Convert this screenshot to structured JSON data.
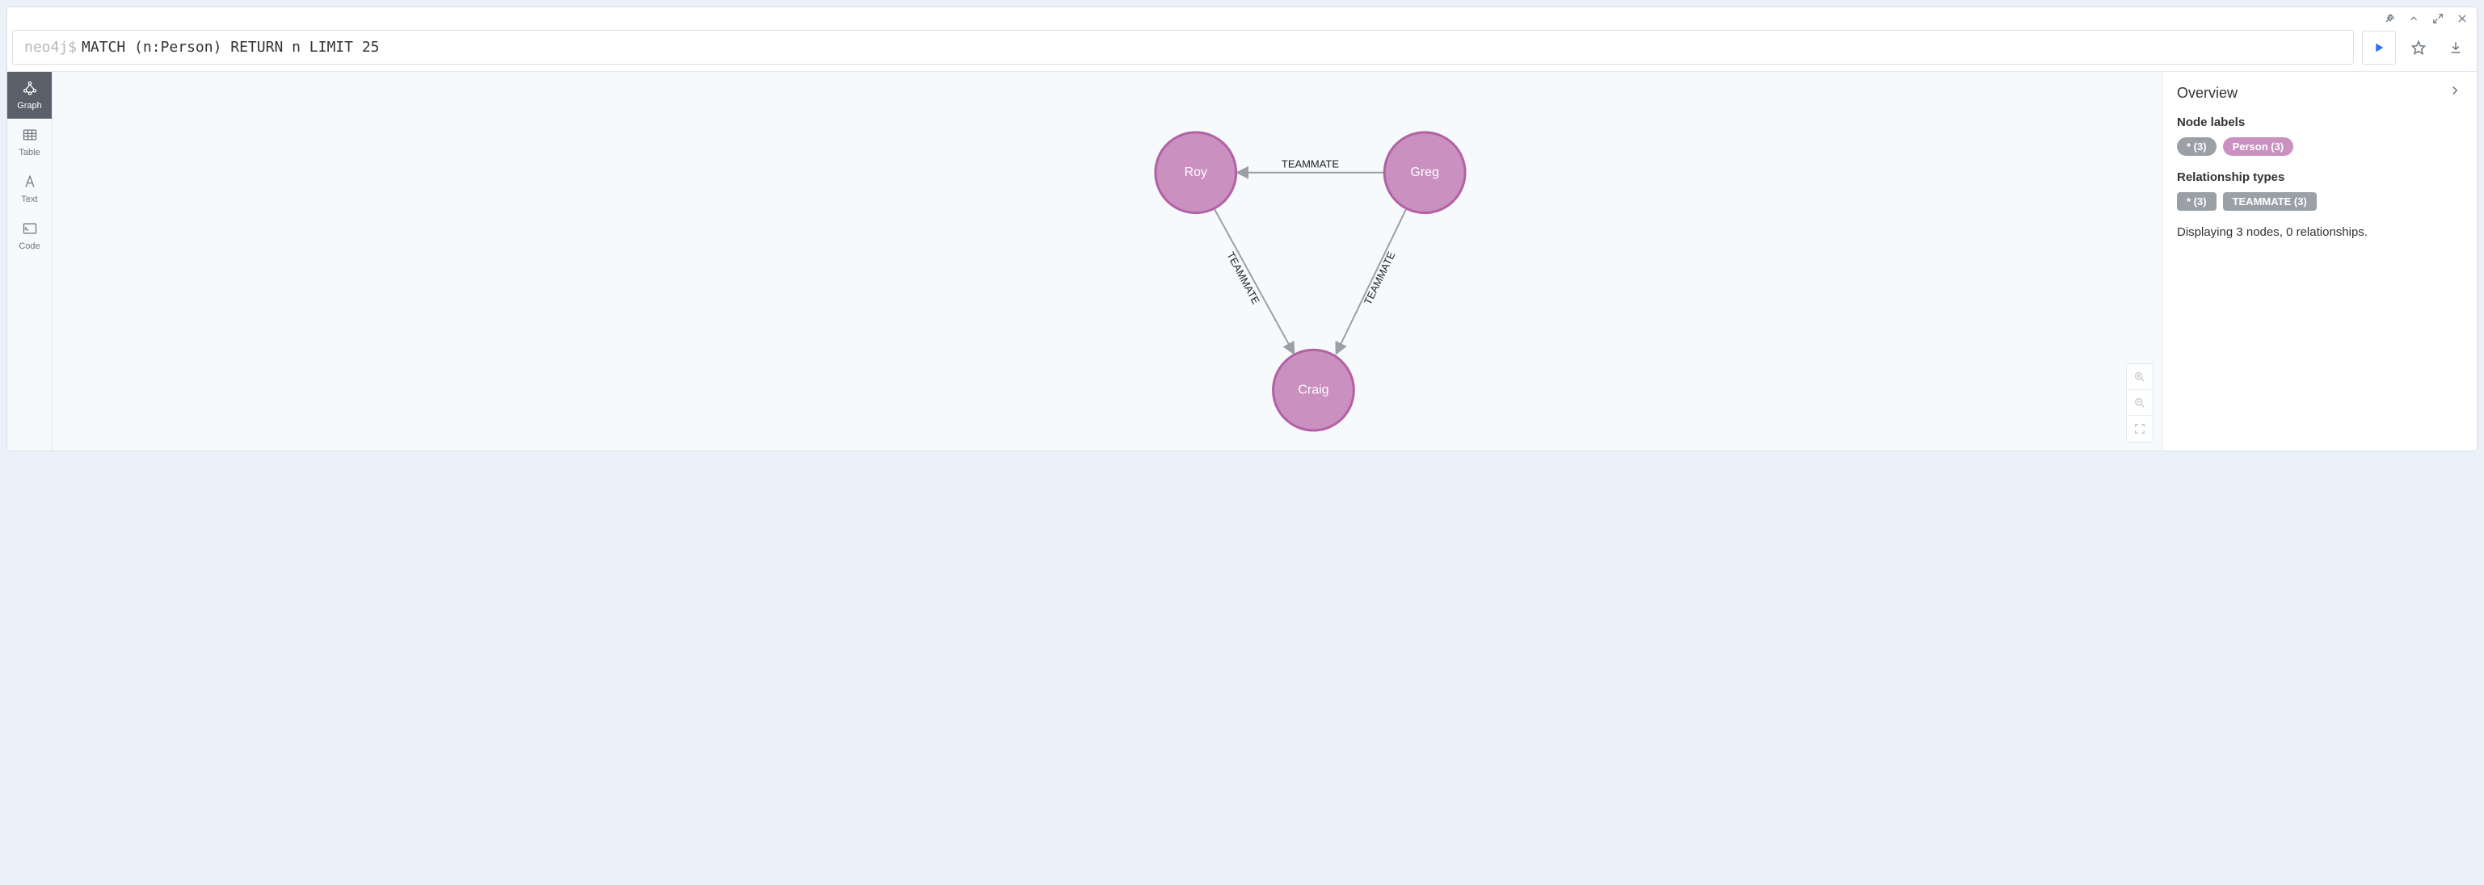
{
  "prompt": "neo4j$",
  "query": "MATCH (n:Person) RETURN n LIMIT 25",
  "sidebar": {
    "items": [
      {
        "label": "Graph"
      },
      {
        "label": "Table"
      },
      {
        "label": "Text"
      },
      {
        "label": "Code"
      }
    ]
  },
  "graph": {
    "nodes": [
      {
        "id": "roy",
        "label": "Roy"
      },
      {
        "id": "greg",
        "label": "Greg"
      },
      {
        "id": "craig",
        "label": "Craig"
      }
    ],
    "edges": [
      {
        "from": "greg",
        "to": "roy",
        "label": "TEAMMATE"
      },
      {
        "from": "roy",
        "to": "craig",
        "label": "TEAMMATE"
      },
      {
        "from": "greg",
        "to": "craig",
        "label": "TEAMMATE"
      }
    ]
  },
  "overview": {
    "title": "Overview",
    "node_labels_title": "Node labels",
    "relationship_types_title": "Relationship types",
    "pills": {
      "all_nodes": "* (3)",
      "person": "Person (3)",
      "all_rels": "* (3)",
      "teammate": "TEAMMATE (3)"
    },
    "status": "Displaying 3 nodes, 0 relationships."
  }
}
